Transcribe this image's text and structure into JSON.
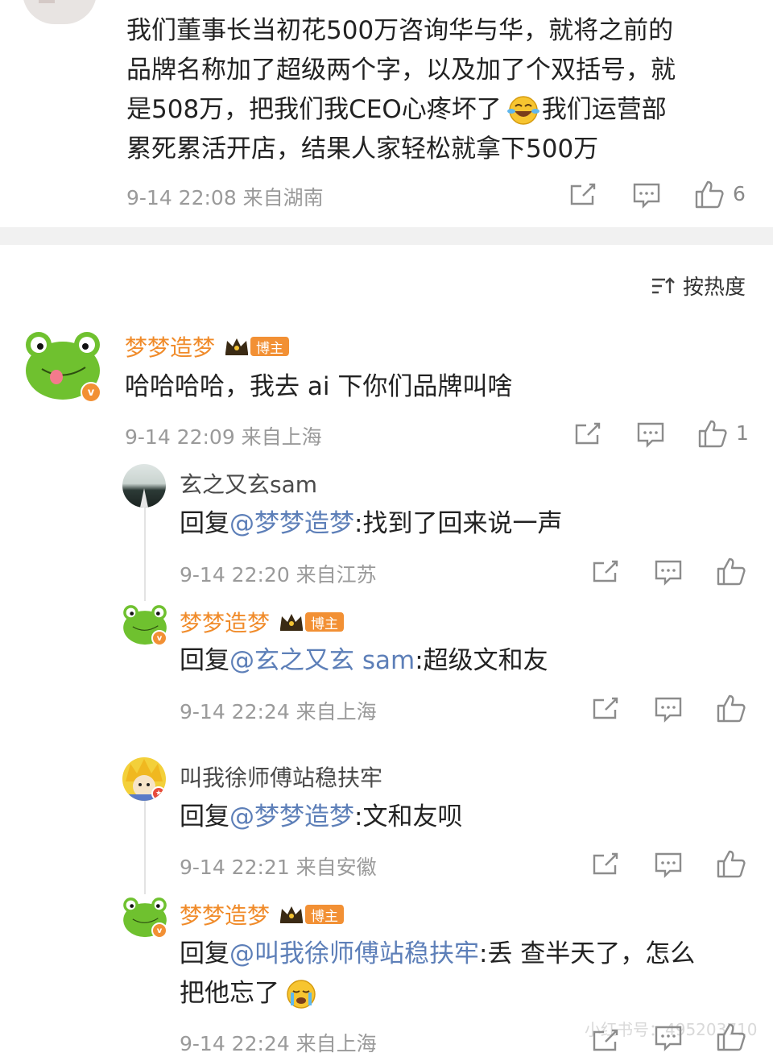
{
  "top_comment": {
    "text_lines": [
      "我们董事长当初花500万咨询华与华，就将之前的",
      "品牌名称加了超级两个字，以及加了个双括号，就",
      "是508万，把我们我CEO心疼坏了",
      "我们运营部",
      "累死累活开店，结果人家轻松就拿下500万"
    ],
    "meta": "9-14 22:08  来自湖南",
    "like_count": "6"
  },
  "sort": {
    "label": "按热度"
  },
  "main_comment": {
    "username": "梦梦造梦",
    "badge": "博主",
    "text": "哈哈哈哈，我去 ai 下你们品牌叫啥",
    "meta": "9-14 22:09  来自上海",
    "like_count": "1"
  },
  "replies": [
    {
      "username": "玄之又玄sam",
      "reply_prefix": "回复",
      "mention": "@梦梦造梦",
      "text": ":找到了回来说一声",
      "meta": "9-14 22:20  来自江苏"
    },
    {
      "username": "梦梦造梦",
      "badge": "博主",
      "reply_prefix": "回复",
      "mention": "@玄之又玄 sam",
      "text": ":超级文和友",
      "meta": "9-14 22:24  来自上海"
    },
    {
      "username": "叫我徐师傅站稳扶牢",
      "reply_prefix": "回复",
      "mention": "@梦梦造梦",
      "text": ":文和友呗",
      "meta": "9-14 22:21  来自安徽"
    },
    {
      "username": "梦梦造梦",
      "badge": "博主",
      "reply_prefix": "回复",
      "mention": "@叫我徐师傅站稳扶牢",
      "text": ":丢 查半天了，怎么",
      "text_line2": "把他忘了",
      "meta": "9-14 22:24  来自上海"
    }
  ],
  "watermark": "小红书号：495203710",
  "icons": {
    "share": "share-icon",
    "comment": "comment-icon",
    "like": "thumbs-up-icon",
    "sort": "sort-icon",
    "emoji_laugh": "laugh-cry-emoji",
    "emoji_cry": "cry-emoji"
  },
  "colors": {
    "accent_orange": "#f08b2a",
    "mention_blue": "#5d7fb8",
    "meta_gray": "#9a9a9a"
  }
}
